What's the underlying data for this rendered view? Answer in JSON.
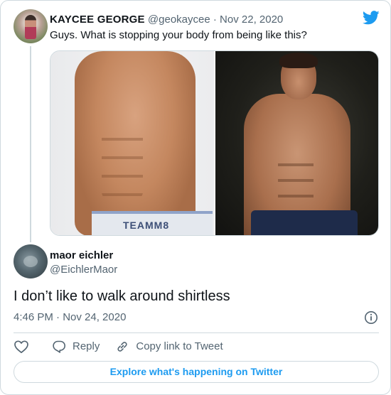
{
  "parent_tweet": {
    "author_name": "KAYCEE GEORGE",
    "handle": "@geokaycee",
    "separator": "·",
    "date": "Nov 22, 2020",
    "text": "Guys. What is stopping your body from being like this?",
    "media": {
      "left_waistband_text": "TEAMM8"
    }
  },
  "reply_tweet": {
    "author_name": "maor eichler",
    "handle": "@EichlerMaor",
    "text": "I don’t like to walk around shirtless",
    "timestamp": "4:46 PM · Nov 24, 2020"
  },
  "actions": {
    "like_icon": "heart-icon",
    "reply_label": "Reply",
    "copy_label": "Copy link to Tweet"
  },
  "explore_button": "Explore what's happening on Twitter",
  "colors": {
    "accent": "#1d9bf0",
    "text": "#0f1419",
    "muted": "#536471",
    "border": "#cfd9de"
  }
}
